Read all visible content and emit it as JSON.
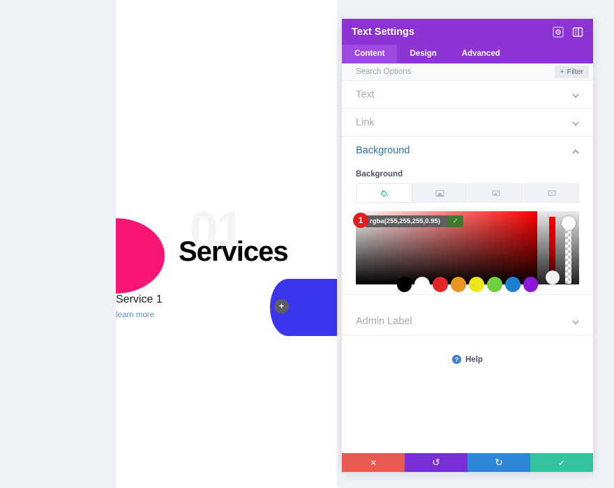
{
  "preview": {
    "watermark_number": "01",
    "heading": "Services",
    "service_title": "Service 1",
    "learn_more": "learn more",
    "add_button": "+",
    "colors": {
      "pink": "#fa1673",
      "blue": "#3b36ee",
      "watermark": "#f3f4f6",
      "heading": "#000000",
      "link": "#5d8fd6",
      "canvas": "#eff3f8"
    }
  },
  "modal": {
    "title": "Text Settings",
    "header_icons": [
      {
        "name": "focus-icon"
      },
      {
        "name": "layout-panel-icon"
      }
    ],
    "tabs": [
      {
        "label": "Content",
        "active": true
      },
      {
        "label": "Design",
        "active": false
      },
      {
        "label": "Advanced",
        "active": false
      }
    ],
    "search": {
      "placeholder": "Search Options",
      "value": ""
    },
    "filter_button": {
      "label": "Filter",
      "plus": "+"
    },
    "sections": [
      {
        "label": "Text",
        "open": false
      },
      {
        "label": "Link",
        "open": false
      },
      {
        "label": "Background",
        "open": true
      },
      {
        "label": "Admin Label",
        "open": false
      }
    ],
    "background": {
      "field_label": "Background",
      "types": [
        {
          "name": "background-color",
          "active": true
        },
        {
          "name": "background-gradient",
          "active": false
        },
        {
          "name": "background-image",
          "active": false
        },
        {
          "name": "background-video",
          "active": false
        }
      ],
      "color_value": "rgba(255,255,255,0.95)",
      "confirm_label": "✓",
      "step_badge": "1",
      "swatches": [
        "#000000",
        "#ffffff",
        "#e3262a",
        "#e79622",
        "#ece71c",
        "#6ccf3b",
        "#1c7fd0",
        "#8a18d8"
      ]
    },
    "help": {
      "label": "Help",
      "icon_char": "?"
    },
    "footer_buttons": [
      {
        "name": "cancel-button",
        "glyph": "✕",
        "color": "#ea5a52"
      },
      {
        "name": "undo-button",
        "glyph": "↺",
        "color": "#7a2fd6"
      },
      {
        "name": "redo-button",
        "glyph": "↻",
        "color": "#2e86d8"
      },
      {
        "name": "save-button",
        "glyph": "✓",
        "color": "#33c3a0"
      }
    ],
    "colors": {
      "header": "#8d34d4",
      "tab_active": "#9c4ae0",
      "section_open": "#2e75a8"
    }
  }
}
